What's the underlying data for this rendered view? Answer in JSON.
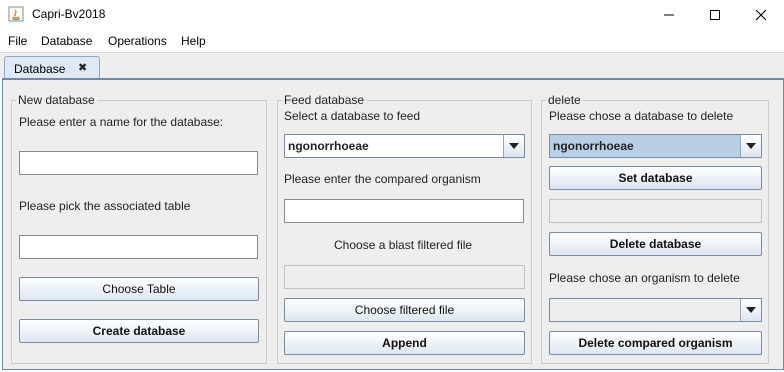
{
  "window": {
    "title": "Capri-Bv2018"
  },
  "menu": [
    "File",
    "Database",
    "Operations",
    "Help"
  ],
  "tab": {
    "label": "Database",
    "close": "✖"
  },
  "new_database": {
    "title": "New database",
    "name_label": "Please enter a name for the database:",
    "name_value": "",
    "table_label": "Please pick the associated table",
    "table_value": "",
    "choose_table": "Choose Table",
    "create": "Create database"
  },
  "feed_database": {
    "title": "Feed database",
    "select_label": "Select a database to feed",
    "selected": "ngonorrhoeae",
    "organism_label": "Please enter the compared organism",
    "organism_value": "",
    "blast_label": "Choose a blast filtered file",
    "blast_value": "",
    "choose_filtered": "Choose filtered file",
    "append": "Append"
  },
  "delete": {
    "title": "delete",
    "choose_label": "Please chose a database to delete",
    "selected": "ngonorrhoeae",
    "set_button": "Set database",
    "db_value": "",
    "delete_button": "Delete database",
    "organism_label": "Please chose an organism to delete",
    "organism_selected": "",
    "delete_organism_button": "Delete compared organism"
  }
}
